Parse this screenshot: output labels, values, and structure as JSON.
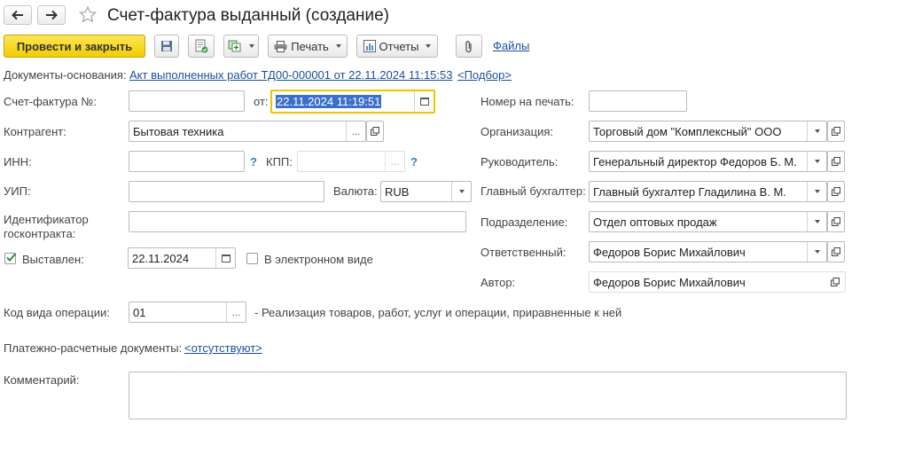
{
  "window": {
    "title": "Счет-фактура выданный (создание)"
  },
  "toolbar": {
    "post_and_close": "Провести и закрыть",
    "print": "Печать",
    "reports": "Отчеты",
    "files": "Файлы"
  },
  "basis": {
    "label": "Документы-основания:",
    "doc_link": "Акт выполненных работ ТД00-000001 от 22.11.2024 11:15:53",
    "pick_link": "<Подбор>"
  },
  "form": {
    "invoice_no_label": "Счет-фактура №:",
    "invoice_no": "",
    "from_label": "от:",
    "from_date": "22.11.2024 11:19:51",
    "contractor_label": "Контрагент:",
    "contractor": "Бытовая техника",
    "inn_label": "ИНН:",
    "inn": "",
    "kpp_label": "КПП:",
    "kpp": "",
    "uip_label": "УИП:",
    "uip": "",
    "currency_label": "Валюта:",
    "currency": "RUB",
    "gov_contract_label_1": "Идентификатор",
    "gov_contract_label_2": "госконтракта:",
    "gov_contract": "",
    "issued_label": "Выставлен:",
    "issued_checked": true,
    "issued_date": "22.11.2024",
    "electronic_label": "В электронном виде",
    "electronic_checked": false,
    "print_number_label": "Номер на печать:",
    "print_number": "",
    "organization_label": "Организация:",
    "organization": "Торговый дом \"Комплексный\" ООО",
    "manager_label": "Руководитель:",
    "manager": "Генеральный директор Федоров Б. М.",
    "accountant_label": "Главный бухгалтер:",
    "accountant": "Главный бухгалтер Гладилина В. М.",
    "department_label": "Подразделение:",
    "department": "Отдел оптовых продаж",
    "responsible_label": "Ответственный:",
    "responsible": "Федоров Борис Михайлович",
    "author_label": "Автор:",
    "author": "Федоров Борис Михайлович",
    "operation_code_label": "Код вида операции:",
    "operation_code": "01",
    "operation_desc": "- Реализация товаров, работ, услуг и операции, приравненные к ней",
    "payment_docs_label": "Платежно-расчетные документы:",
    "payment_docs_link": "<отсутствуют>",
    "comment_label": "Комментарий:",
    "comment": ""
  },
  "icons": {
    "question": "?",
    "ellipsis": "...",
    "currency_dropdown": "▾"
  },
  "colors": {
    "primary_button": "#f2cc00",
    "link": "#1c4fa0",
    "focus_border": "#f0c400",
    "selection": "#3b6fc9"
  }
}
